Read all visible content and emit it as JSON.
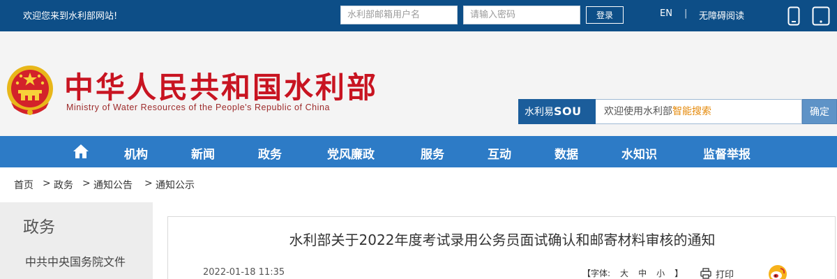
{
  "topbar": {
    "welcome": "欢迎您来到水利部网站!",
    "username_placeholder": "水利部邮箱用户名",
    "password_placeholder": "请输入密码",
    "login_label": "登录",
    "lang": "EN",
    "separator": "|",
    "accessibility": "无障碍阅读",
    "bg_color": "#0d4e87"
  },
  "header": {
    "title_cn": "中华人民共和国水利部",
    "title_en": "Ministry of Water Resources of the People's Republic of China",
    "emblem_icon": "national-emblem-icon"
  },
  "search": {
    "brand_prefix": "水利易",
    "brand_suffix": "SOU",
    "hint_prefix": "欢迎使用水利部",
    "hint_highlight": "智能搜索",
    "button_label": "确定"
  },
  "nav": {
    "home_icon": "home-icon",
    "items": [
      "机构",
      "新闻",
      "政务",
      "党风廉政",
      "服务",
      "互动",
      "数据",
      "水知识",
      "监督举报"
    ],
    "bg_color": "#2d7bc6"
  },
  "breadcrumb": {
    "items": [
      "首页",
      "政务",
      "通知公告",
      "通知公示"
    ],
    "separator": ">"
  },
  "sidebar": {
    "title": "政务",
    "item": "中共中央国务院文件"
  },
  "article": {
    "title": "水利部关于2022年度考试录用公务员面试确认和邮寄材料审核的通知",
    "date": "2022-01-18 11:35",
    "font_label": "【字体:",
    "font_large": "大",
    "font_medium": "中",
    "font_small": "小",
    "font_close": "】",
    "print_label": "打印"
  }
}
